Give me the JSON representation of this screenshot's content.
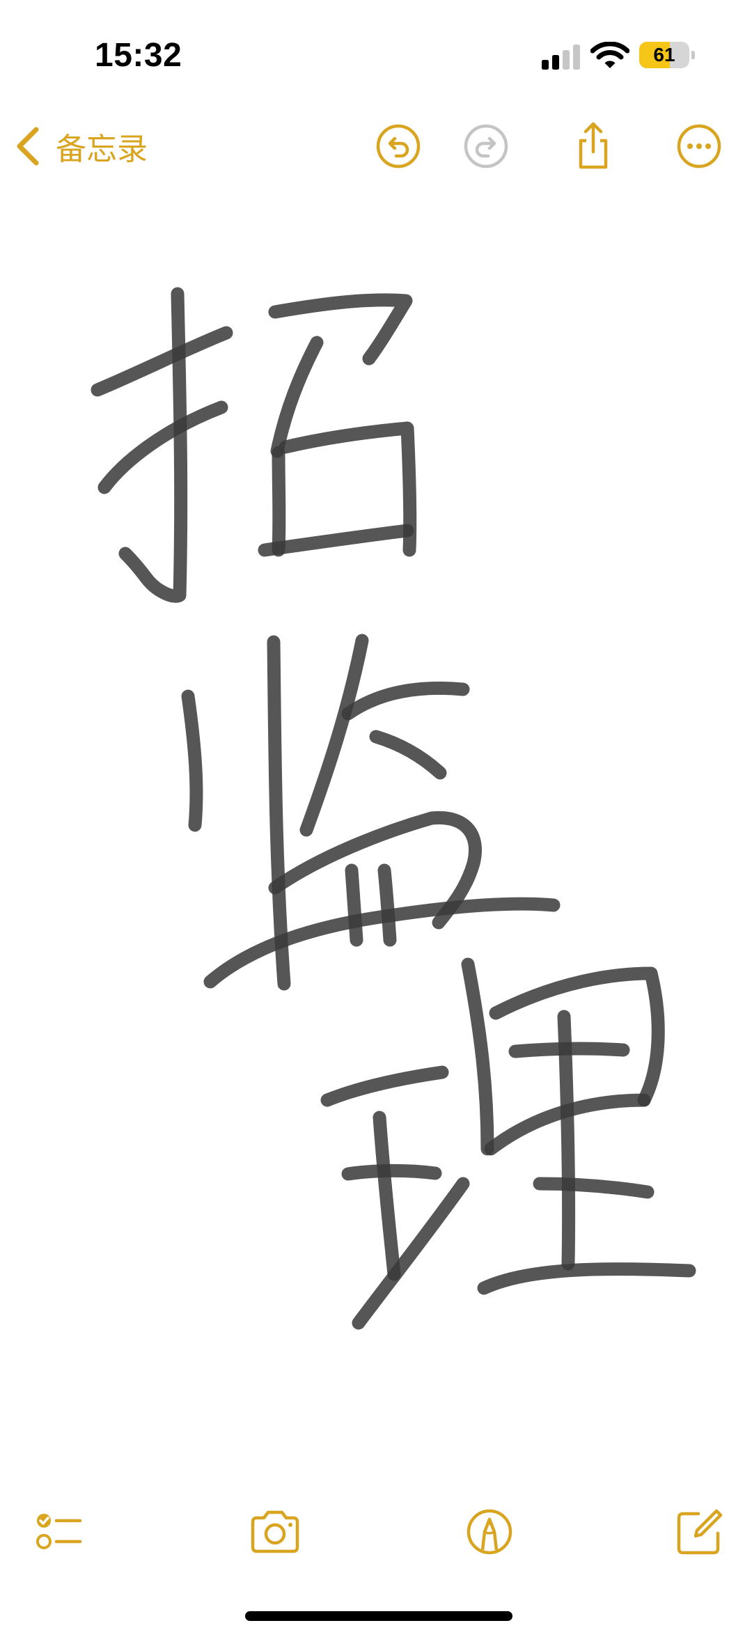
{
  "status_bar": {
    "time": "15:32",
    "battery_level": "61",
    "battery_fraction": 0.61,
    "cellular_bars_active": 2,
    "cellular_bars_total": 4
  },
  "nav": {
    "back_label": "备忘录",
    "icons": [
      "chevron-left-icon",
      "undo-icon",
      "redo-icon",
      "share-icon",
      "more-icon"
    ]
  },
  "note": {
    "content_type": "handwriting-drawing"
  },
  "toolbar": {
    "icons": [
      "checklist-icon",
      "camera-icon",
      "markup-pen-icon",
      "compose-icon"
    ]
  },
  "colors": {
    "accent": "#d9a521",
    "disabled": "#c4c4c4",
    "ink": "#3a3a3a",
    "battery": "#f5c518"
  }
}
